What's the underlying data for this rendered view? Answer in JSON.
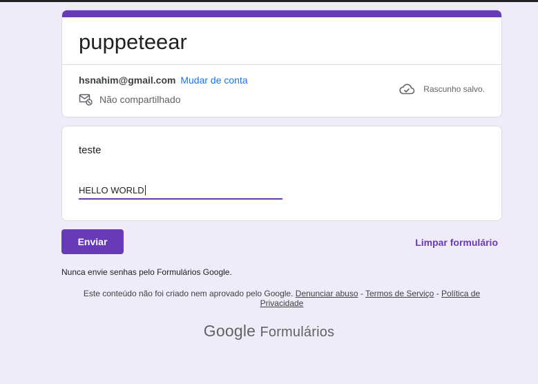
{
  "form": {
    "title": "puppeteear",
    "account_email": "hsnahim@gmail.com",
    "switch_account": "Mudar de conta",
    "share_status": "Não compartilhado",
    "draft_status": "Rascunho salvo."
  },
  "question": {
    "title": "teste",
    "answer_value": "HELLO WORLD"
  },
  "actions": {
    "submit_label": "Enviar",
    "clear_label": "Limpar formulário"
  },
  "footer": {
    "warning": "Nunca envie senhas pelo Formulários Google.",
    "disclaimer": "Este conteúdo não foi criado nem aprovado pelo Google.",
    "report_abuse": "Denunciar abuso",
    "separator": "-",
    "terms": "Termos de Serviço",
    "privacy": "Política de Privacidade",
    "brand_google": "Google",
    "brand_product": "Formulários"
  },
  "colors": {
    "accent": "#673ab7",
    "background": "#f0ebf8",
    "link": "#1a73e8"
  },
  "icons": {
    "share": "mail-lock-icon",
    "draft": "cloud-check-icon"
  }
}
